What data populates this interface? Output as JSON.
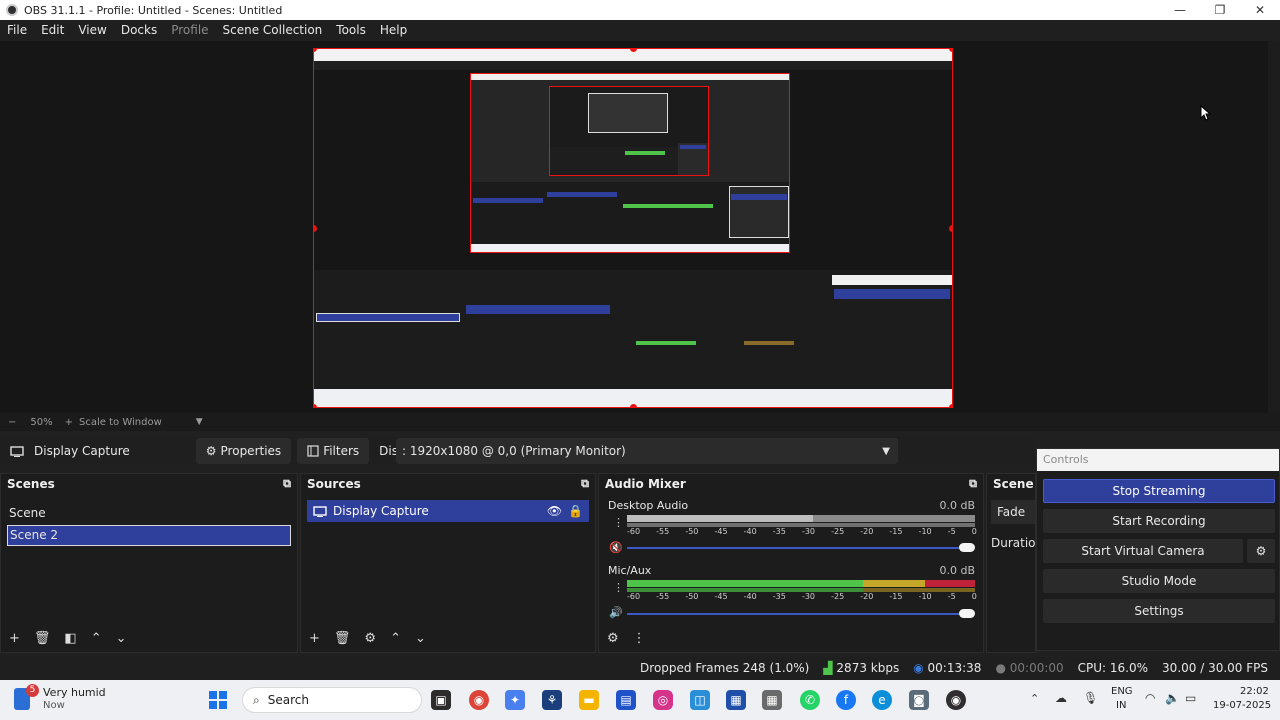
{
  "window": {
    "title": "OBS 31.1.1 - Profile: Untitled - Scenes: Untitled",
    "controls": [
      "—",
      "❐",
      "✕"
    ]
  },
  "menu": {
    "items": [
      {
        "label": "File",
        "disabled": false
      },
      {
        "label": "Edit",
        "disabled": false
      },
      {
        "label": "View",
        "disabled": false
      },
      {
        "label": "Docks",
        "disabled": false
      },
      {
        "label": "Profile",
        "disabled": true
      },
      {
        "label": "Scene Collection",
        "disabled": false
      },
      {
        "label": "Tools",
        "disabled": false
      },
      {
        "label": "Help",
        "disabled": false
      }
    ]
  },
  "zoom": {
    "minus": "−",
    "level": "50%",
    "plus": "+",
    "mode": "Scale to Window"
  },
  "context": {
    "source_name": "Display Capture",
    "properties": "Properties",
    "filters": "Filters",
    "display_label": "Display",
    "display_value": ": 1920x1080 @ 0,0 (Primary Monitor)"
  },
  "scenes": {
    "title": "Scenes",
    "items": [
      "Scene",
      "Scene 2"
    ],
    "selected": "Scene 2"
  },
  "sources": {
    "title": "Sources",
    "items": [
      "Display Capture"
    ]
  },
  "audio_mixer": {
    "title": "Audio Mixer",
    "tick_labels": [
      "-60",
      "-55",
      "-50",
      "-45",
      "-40",
      "-35",
      "-30",
      "-25",
      "-20",
      "-15",
      "-10",
      "-5",
      "0"
    ],
    "channels": [
      {
        "name": "Desktop Audio",
        "db": "0.0 dB",
        "level": 0.0,
        "muted": true
      },
      {
        "name": "Mic/Aux",
        "db": "0.0 dB",
        "level": 0.75,
        "muted": false
      }
    ]
  },
  "transitions": {
    "title": "Scene Tr",
    "fade": "Fade",
    "duration": "Duration"
  },
  "controls": {
    "title": "Controls",
    "buttons": [
      {
        "label": "Stop Streaming",
        "active": true
      },
      {
        "label": "Start Recording",
        "active": false
      },
      {
        "label": "Start Virtual Camera",
        "active": false
      },
      {
        "label": "Studio Mode",
        "active": false
      },
      {
        "label": "Settings",
        "active": false
      }
    ]
  },
  "status": {
    "dropped_frames": "Dropped Frames 248 (1.0%)",
    "bitrate": "2873 kbps",
    "stream_time": "00:13:38",
    "record_time": "00:00:00",
    "cpu": "CPU: 16.0%",
    "fps": "30.00 / 30.00 FPS"
  },
  "taskbar": {
    "weather_temp": "5",
    "weather_title": "Very humid",
    "weather_sub": "Now",
    "search": "Search",
    "lang_top": "ENG",
    "lang_bottom": "IN",
    "time": "22:02",
    "date": "19-07-2025"
  },
  "colors": {
    "accent": "#2f3f9c",
    "selection_border": "#e11111",
    "meter_green": "#4ec44a",
    "meter_yellow": "#c5a72a",
    "meter_red": "#c0223a"
  }
}
